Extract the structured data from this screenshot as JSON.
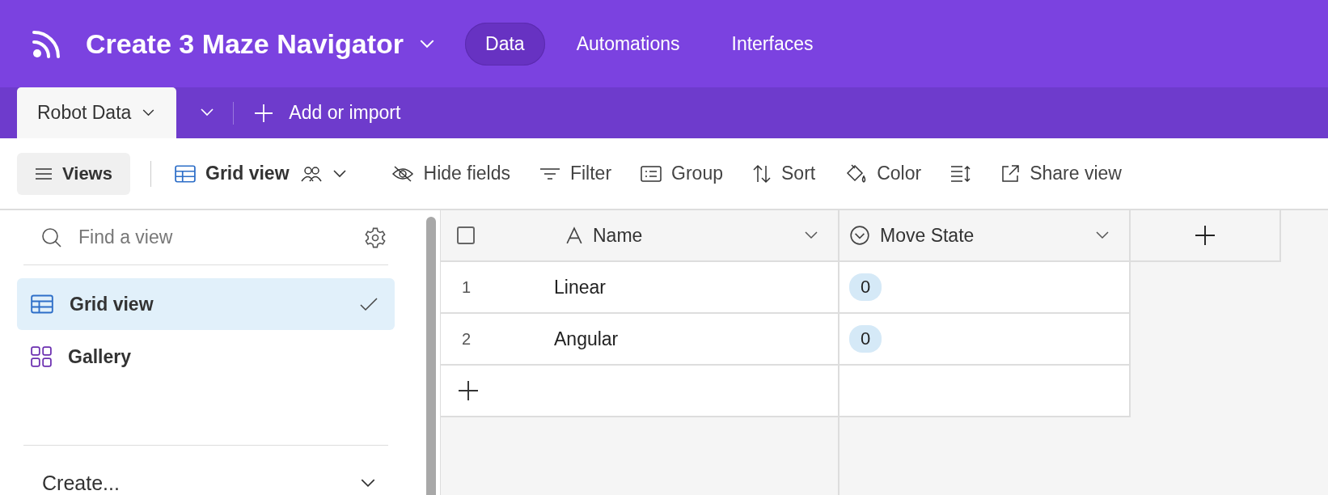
{
  "app": {
    "title": "Create 3 Maze Navigator",
    "nav": [
      {
        "label": "Data",
        "selected": true
      },
      {
        "label": "Automations",
        "selected": false
      },
      {
        "label": "Interfaces",
        "selected": false
      }
    ]
  },
  "tables": [
    {
      "label": "Robot Data",
      "selected": true
    }
  ],
  "add_table": "Add or import",
  "toolbar": {
    "views_button": "Views",
    "view_name": "Grid view",
    "actions": [
      {
        "kind": "hide",
        "label": "Hide fields"
      },
      {
        "kind": "filter",
        "label": "Filter"
      },
      {
        "kind": "group",
        "label": "Group"
      },
      {
        "kind": "sort",
        "label": "Sort"
      },
      {
        "kind": "color",
        "label": "Color"
      },
      {
        "kind": "height"
      },
      {
        "kind": "share",
        "label": "Share view"
      }
    ]
  },
  "sidebar": {
    "search_placeholder": "Find a view",
    "views": [
      {
        "label": "Grid view",
        "kind": "grid",
        "selected": true
      },
      {
        "label": "Gallery",
        "kind": "gallery",
        "selected": false
      }
    ],
    "create_label": "Create..."
  },
  "table": {
    "select_all_checked": false,
    "columns": [
      {
        "label": "Name",
        "kind": "text"
      },
      {
        "label": "Move State",
        "kind": "select"
      }
    ],
    "rows": [
      {
        "number": "1",
        "name": "Linear",
        "move_state": "0"
      },
      {
        "number": "2",
        "name": "Angular",
        "move_state": "0"
      }
    ]
  }
}
